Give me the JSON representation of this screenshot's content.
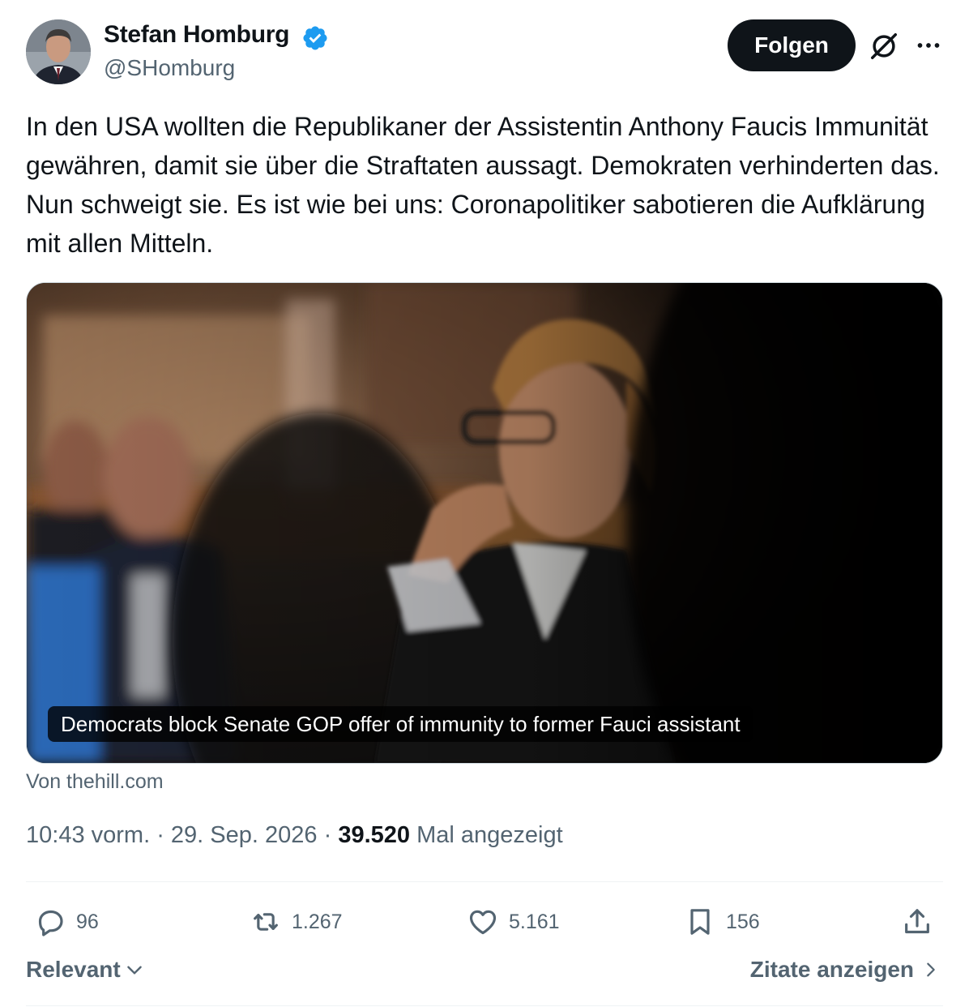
{
  "author": {
    "name": "Stefan Homburg",
    "handle": "@SHomburg",
    "follow_label": "Folgen"
  },
  "tweet": {
    "text": "In den USA wollten die Republikaner der Assistentin Anthony Faucis Immunität gewähren, damit sie über die Straftaten aussagt. Demokraten verhinderten das. Nun schweigt sie. Es ist wie bei uns: Coronapolitiker sabotieren die Aufklärung mit allen Mitteln."
  },
  "card": {
    "headline": "Democrats block Senate GOP offer of immunity to former Fauci assistant",
    "source": "Von thehill.com"
  },
  "meta": {
    "time": "10:43 vorm.",
    "sep1": " · ",
    "date": "29. Sep. 2026",
    "sep2": " · ",
    "views": "39.520",
    "views_label": " Mal angezeigt"
  },
  "actions": {
    "replies": "96",
    "reposts": "1.267",
    "likes": "5.161",
    "bookmarks": "156"
  },
  "footer": {
    "sort_label": "Relevant",
    "quotes_label": "Zitate anzeigen"
  },
  "colors": {
    "verified_blue": "#1d9bf0",
    "text_primary": "#0f1419",
    "text_secondary": "#536471"
  },
  "icons": [
    "verified-badge-icon",
    "grok-icon",
    "more-icon",
    "reply-icon",
    "repost-icon",
    "like-icon",
    "bookmark-icon",
    "share-icon",
    "chevron-down-icon",
    "chevron-right-icon"
  ]
}
